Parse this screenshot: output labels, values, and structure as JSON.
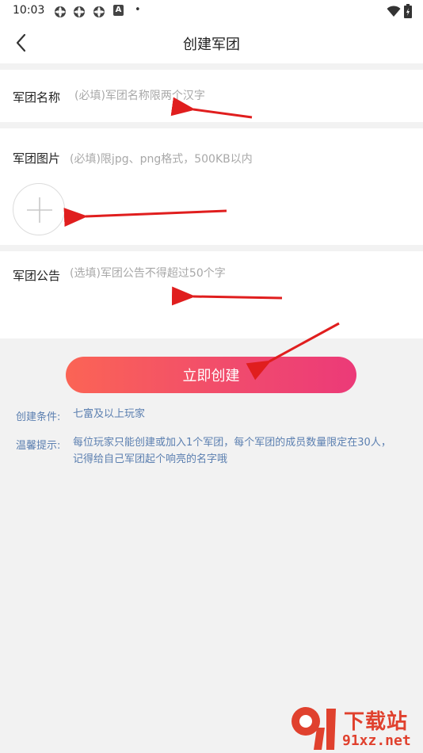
{
  "status_bar": {
    "time": "10:03",
    "left_icons": [
      "app-icon",
      "app-icon",
      "app-icon",
      "a-badge-icon"
    ],
    "dot": "•",
    "a_badge": "A"
  },
  "nav": {
    "title": "创建军团"
  },
  "form": {
    "name_label": "军团名称",
    "name_placeholder": "(必填)军团名称限两个汉字",
    "image_label": "军团图片",
    "image_hint": "(必填)限jpg、png格式，500KB以内",
    "notice_label": "军团公告",
    "notice_placeholder": "(选填)军团公告不得超过50个字"
  },
  "create_button": {
    "label": "立即创建"
  },
  "info": {
    "condition_label": "创建条件:",
    "condition_text": "七富及以上玩家",
    "tip_label": "温馨提示:",
    "tip_line1": "每位玩家只能创建或加入1个军团，每个军团的成员数量限定在30人，",
    "tip_line2": "记得给自己军团起个响亮的名字哦"
  },
  "watermark": {
    "brand_top": "下载站",
    "brand_bottom": "91xz.net"
  },
  "colors": {
    "button_gradient_start": "#fb6455",
    "button_gradient_end": "#ec3a78",
    "info_text": "#5b7fb0",
    "annotation_arrow": "#e01e1e",
    "watermark": "#e0412e"
  }
}
